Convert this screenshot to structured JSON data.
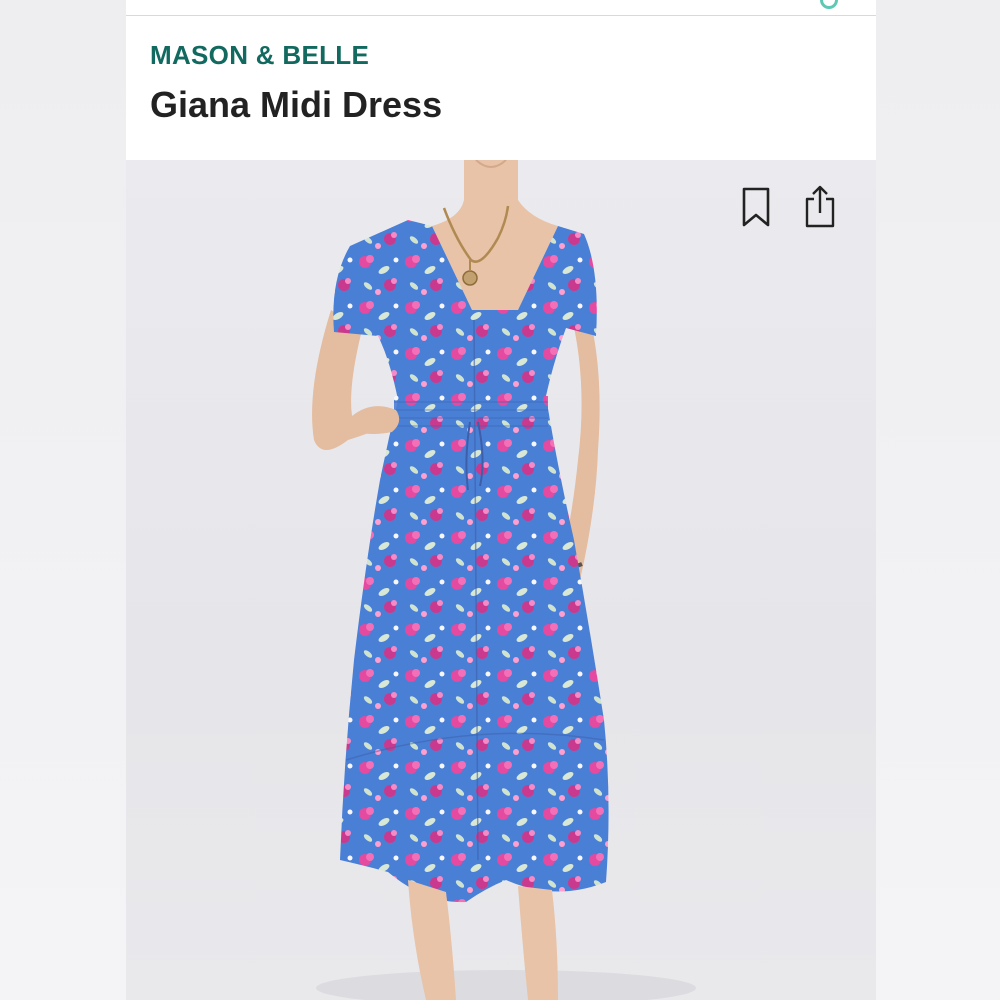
{
  "product": {
    "brand": "MASON & BELLE",
    "name": "Giana Midi Dress"
  },
  "colors": {
    "brand_text": "#11695f",
    "title_text": "#222222",
    "dress_base": "#4a7fd6",
    "dress_print": "#e34aa0",
    "accent_dot": "#5ec8b4"
  },
  "icons": {
    "save": "bookmark-icon",
    "share": "share-icon"
  }
}
